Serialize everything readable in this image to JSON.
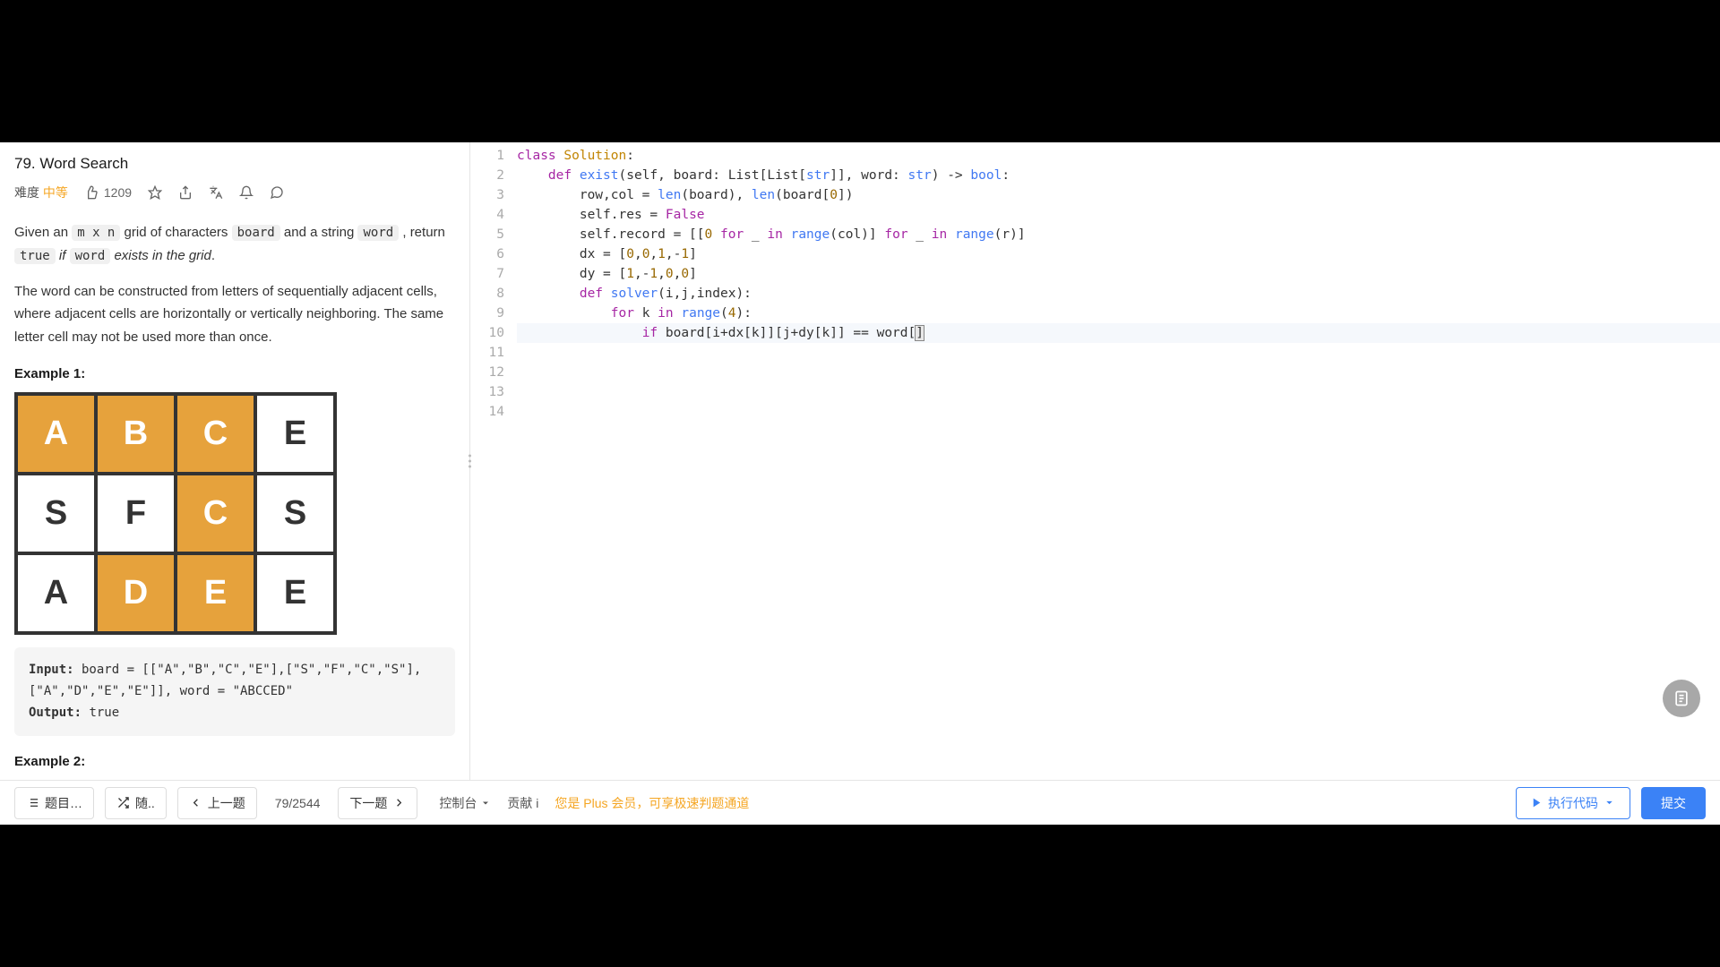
{
  "problem": {
    "title": "79. Word Search",
    "difficulty_label": "难度",
    "difficulty_value": "中等",
    "likes": "1209",
    "description_html": "Given an <code>m x n</code> grid of characters <code>board</code> and a string <code>word</code> , return <code>true</code> <em>if</em> <code>word</code> <em>exists in the grid</em>.",
    "description2": "The word can be constructed from letters of sequentially adjacent cells, where adjacent cells are horizontally or vertically neighboring. The same letter cell may not be used more than once.",
    "example1_label": "Example 1:",
    "example2_label": "Example 2:",
    "grid": [
      [
        {
          "t": "A",
          "h": true
        },
        {
          "t": "B",
          "h": true
        },
        {
          "t": "C",
          "h": true
        },
        {
          "t": "E",
          "h": false
        }
      ],
      [
        {
          "t": "S",
          "h": false
        },
        {
          "t": "F",
          "h": false
        },
        {
          "t": "C",
          "h": true
        },
        {
          "t": "S",
          "h": false
        }
      ],
      [
        {
          "t": "A",
          "h": false
        },
        {
          "t": "D",
          "h": true
        },
        {
          "t": "E",
          "h": true
        },
        {
          "t": "E",
          "h": false
        }
      ]
    ],
    "example1_input_label": "Input:",
    "example1_input": " board = [[\"A\",\"B\",\"C\",\"E\"],[\"S\",\"F\",\"C\",\"S\"],[\"A\",\"D\",\"E\",\"E\"]], word = \"ABCCED\"",
    "example1_output_label": "Output:",
    "example1_output": " true"
  },
  "editor": {
    "lines": [
      {
        "n": 1,
        "seg": [
          {
            "t": "class ",
            "c": "kw"
          },
          {
            "t": "Solution",
            "c": "cls"
          },
          {
            "t": ":"
          }
        ]
      },
      {
        "n": 2,
        "seg": [
          {
            "t": "    "
          },
          {
            "t": "def ",
            "c": "kw"
          },
          {
            "t": "exist",
            "c": "fn"
          },
          {
            "t": "(self, board: List[List["
          },
          {
            "t": "str",
            "c": "builtin"
          },
          {
            "t": "]], word: "
          },
          {
            "t": "str",
            "c": "builtin"
          },
          {
            "t": ") -> "
          },
          {
            "t": "bool",
            "c": "builtin"
          },
          {
            "t": ":"
          }
        ]
      },
      {
        "n": 3,
        "seg": [
          {
            "t": "        row,col = "
          },
          {
            "t": "len",
            "c": "builtin"
          },
          {
            "t": "(board), "
          },
          {
            "t": "len",
            "c": "builtin"
          },
          {
            "t": "(board["
          },
          {
            "t": "0",
            "c": "num"
          },
          {
            "t": "])"
          }
        ]
      },
      {
        "n": 4,
        "seg": [
          {
            "t": "        self.res = "
          },
          {
            "t": "False",
            "c": "kw"
          }
        ]
      },
      {
        "n": 5,
        "seg": [
          {
            "t": "        self.record = [["
          },
          {
            "t": "0",
            "c": "num"
          },
          {
            "t": " "
          },
          {
            "t": "for",
            "c": "kw"
          },
          {
            "t": " _ "
          },
          {
            "t": "in",
            "c": "kw"
          },
          {
            "t": " "
          },
          {
            "t": "range",
            "c": "builtin"
          },
          {
            "t": "(col)] "
          },
          {
            "t": "for",
            "c": "kw"
          },
          {
            "t": " _ "
          },
          {
            "t": "in",
            "c": "kw"
          },
          {
            "t": " "
          },
          {
            "t": "range",
            "c": "builtin"
          },
          {
            "t": "(r)]"
          }
        ]
      },
      {
        "n": 6,
        "seg": [
          {
            "t": "        dx = ["
          },
          {
            "t": "0",
            "c": "num"
          },
          {
            "t": ","
          },
          {
            "t": "0",
            "c": "num"
          },
          {
            "t": ","
          },
          {
            "t": "1",
            "c": "num"
          },
          {
            "t": ",-"
          },
          {
            "t": "1",
            "c": "num"
          },
          {
            "t": "]"
          }
        ]
      },
      {
        "n": 7,
        "seg": [
          {
            "t": "        dy = ["
          },
          {
            "t": "1",
            "c": "num"
          },
          {
            "t": ",-"
          },
          {
            "t": "1",
            "c": "num"
          },
          {
            "t": ","
          },
          {
            "t": "0",
            "c": "num"
          },
          {
            "t": ","
          },
          {
            "t": "0",
            "c": "num"
          },
          {
            "t": "]"
          }
        ]
      },
      {
        "n": 8,
        "seg": [
          {
            "t": "        "
          },
          {
            "t": "def ",
            "c": "kw"
          },
          {
            "t": "solver",
            "c": "fn"
          },
          {
            "t": "(i,j,index):"
          }
        ]
      },
      {
        "n": 9,
        "seg": [
          {
            "t": "            "
          },
          {
            "t": "for",
            "c": "kw"
          },
          {
            "t": " k "
          },
          {
            "t": "in",
            "c": "kw"
          },
          {
            "t": " "
          },
          {
            "t": "range",
            "c": "builtin"
          },
          {
            "t": "("
          },
          {
            "t": "4",
            "c": "num"
          },
          {
            "t": "):"
          }
        ]
      },
      {
        "n": 10,
        "active": true,
        "seg": [
          {
            "t": "                "
          },
          {
            "t": "if",
            "c": "kw"
          },
          {
            "t": " board[i+dx[k]][j+dy[k]] == word["
          },
          {
            "t": "]",
            "c": "cursor-mark"
          }
        ]
      },
      {
        "n": 11,
        "seg": []
      },
      {
        "n": 12,
        "seg": []
      },
      {
        "n": 13,
        "seg": []
      },
      {
        "n": 14,
        "seg": []
      }
    ]
  },
  "footer": {
    "list_btn": "题目…",
    "shuffle_btn": "随..",
    "prev_btn": "上一题",
    "counter": "79/2544",
    "next_btn": "下一题",
    "console": "控制台",
    "contrib": "贡献 i",
    "plus_msg": "您是 Plus 会员，可享极速判题通道",
    "run_btn": "执行代码",
    "submit_btn": "提交"
  }
}
